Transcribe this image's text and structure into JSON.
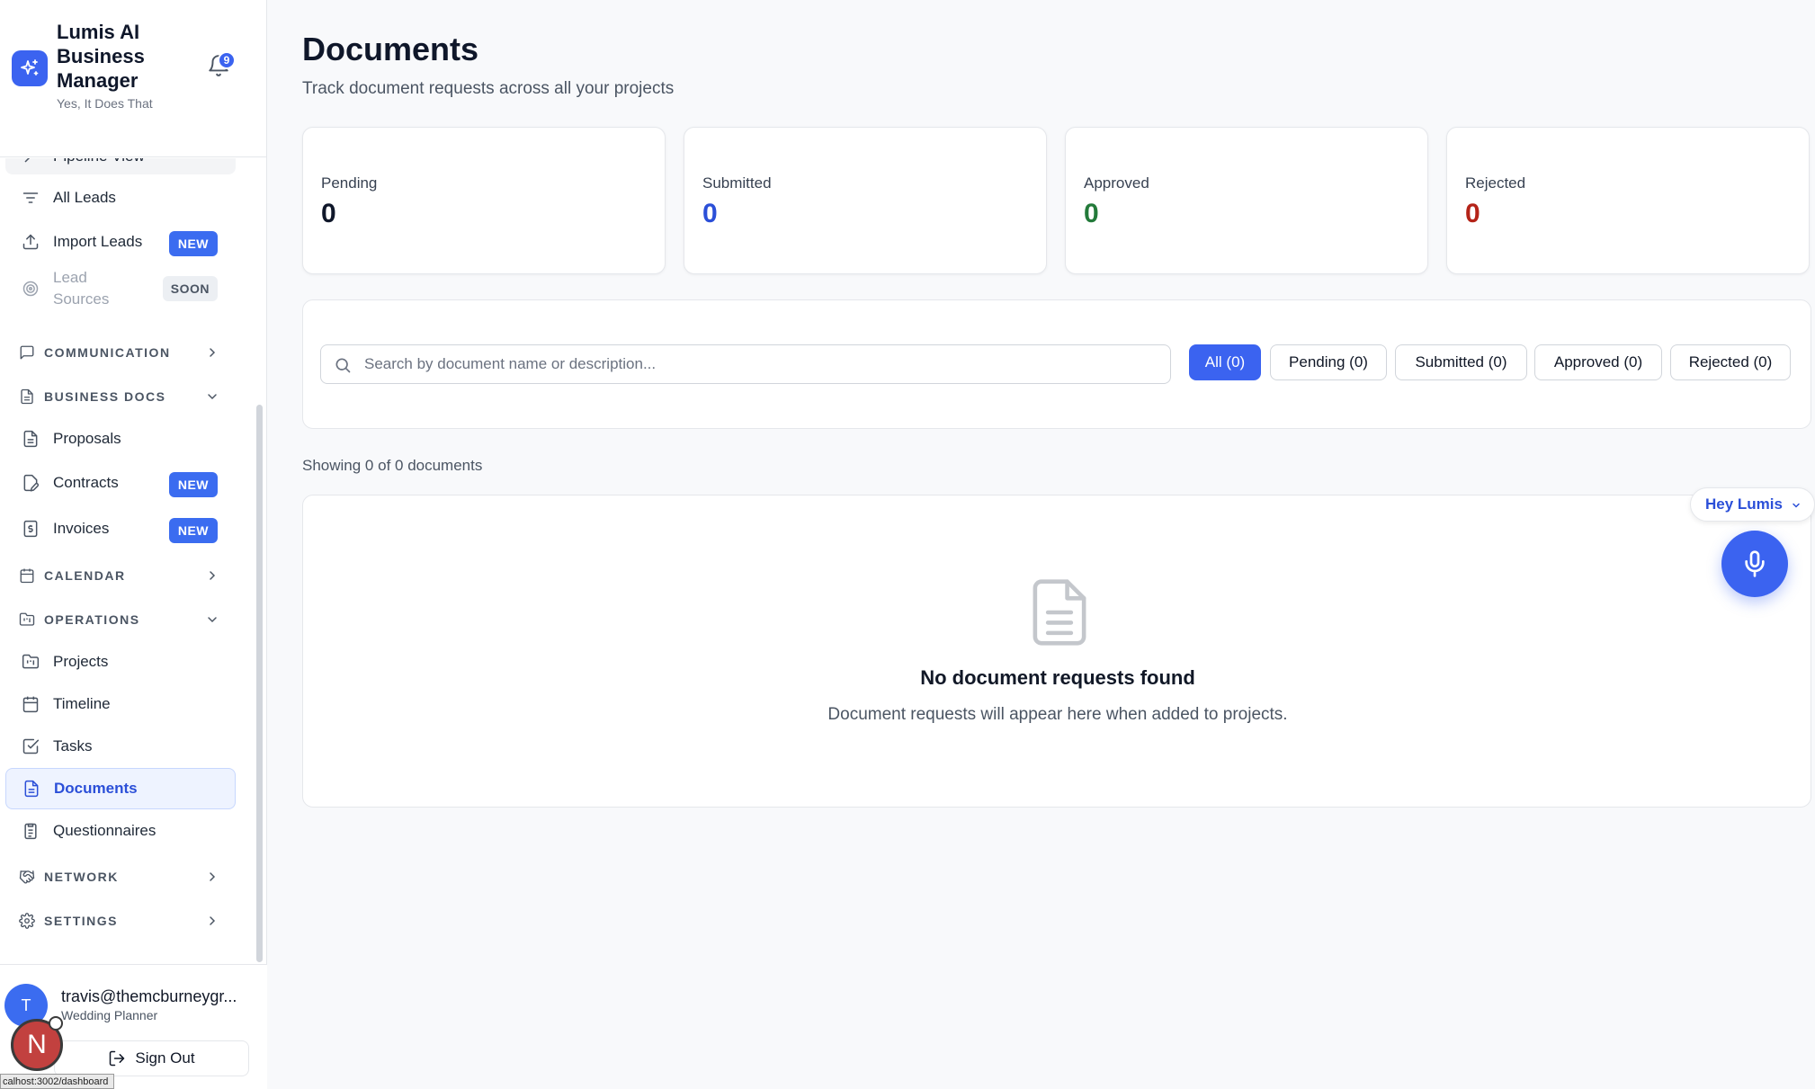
{
  "brand": {
    "name": "Lumis AI Business Manager",
    "tagline": "Yes, It Does That",
    "notification_count": "9"
  },
  "sidebar": {
    "partial_item": "Pipeline View",
    "items": [
      {
        "label": "All Leads"
      },
      {
        "label": "Import Leads",
        "badge": "NEW"
      },
      {
        "label": "Lead Sources",
        "badge": "SOON"
      },
      {
        "label": "Proposals"
      },
      {
        "label": "Contracts",
        "badge": "NEW"
      },
      {
        "label": "Invoices",
        "badge": "NEW"
      },
      {
        "label": "Projects"
      },
      {
        "label": "Timeline"
      },
      {
        "label": "Tasks"
      },
      {
        "label": "Documents"
      },
      {
        "label": "Questionnaires"
      }
    ],
    "sections": {
      "communication": "COMMUNICATION",
      "business_docs": "BUSINESS DOCS",
      "calendar": "CALENDAR",
      "operations": "OPERATIONS",
      "network": "NETWORK",
      "settings": "SETTINGS"
    }
  },
  "user": {
    "initial": "T",
    "email": "travis@themcburneygr...",
    "role": "Wedding Planner",
    "signout_label": "Sign Out"
  },
  "overlay": {
    "n_initial": "N",
    "status_url": "calhost:3002/dashboard"
  },
  "page": {
    "title": "Documents",
    "subtitle": "Track document requests across all your projects"
  },
  "stats": [
    {
      "label": "Pending",
      "value": "0",
      "color": "#0f172a"
    },
    {
      "label": "Submitted",
      "value": "0",
      "color": "#2b4fd8"
    },
    {
      "label": "Approved",
      "value": "0",
      "color": "#237a3a"
    },
    {
      "label": "Rejected",
      "value": "0",
      "color": "#b42318"
    }
  ],
  "search": {
    "placeholder": "Search by document name or description...",
    "value": ""
  },
  "filters": [
    {
      "label": "All (0)",
      "active": true
    },
    {
      "label": "Pending (0)"
    },
    {
      "label": "Submitted (0)"
    },
    {
      "label": "Approved (0)"
    },
    {
      "label": "Rejected (0)"
    }
  ],
  "showing_text": "Showing 0 of 0 documents",
  "empty": {
    "title": "No document requests found",
    "subtitle": "Document requests will appear here when added to projects."
  },
  "assistant": {
    "label": "Hey Lumis"
  },
  "colors": {
    "accent": "#3b63f0",
    "badge_new": "#3b6cf0"
  }
}
